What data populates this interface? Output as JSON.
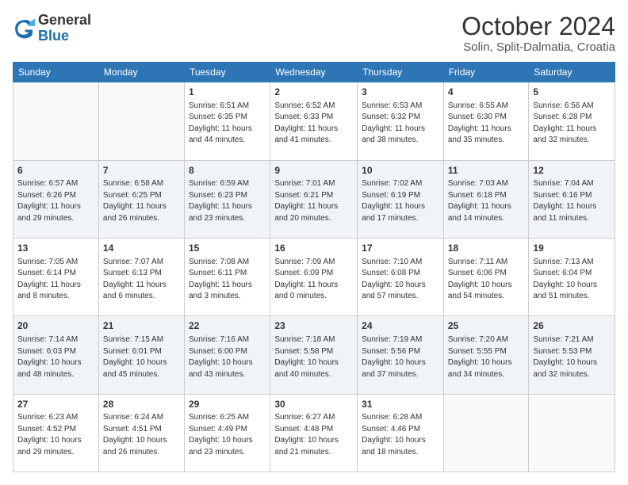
{
  "header": {
    "logo_general": "General",
    "logo_blue": "Blue",
    "title": "October 2024",
    "subtitle": "Solin, Split-Dalmatia, Croatia"
  },
  "calendar": {
    "days": [
      "Sunday",
      "Monday",
      "Tuesday",
      "Wednesday",
      "Thursday",
      "Friday",
      "Saturday"
    ],
    "weeks": [
      [
        {
          "day": "",
          "info": ""
        },
        {
          "day": "",
          "info": ""
        },
        {
          "day": "1",
          "info": "Sunrise: 6:51 AM\nSunset: 6:35 PM\nDaylight: 11 hours and 44 minutes."
        },
        {
          "day": "2",
          "info": "Sunrise: 6:52 AM\nSunset: 6:33 PM\nDaylight: 11 hours and 41 minutes."
        },
        {
          "day": "3",
          "info": "Sunrise: 6:53 AM\nSunset: 6:32 PM\nDaylight: 11 hours and 38 minutes."
        },
        {
          "day": "4",
          "info": "Sunrise: 6:55 AM\nSunset: 6:30 PM\nDaylight: 11 hours and 35 minutes."
        },
        {
          "day": "5",
          "info": "Sunrise: 6:56 AM\nSunset: 6:28 PM\nDaylight: 11 hours and 32 minutes."
        }
      ],
      [
        {
          "day": "6",
          "info": "Sunrise: 6:57 AM\nSunset: 6:26 PM\nDaylight: 11 hours and 29 minutes."
        },
        {
          "day": "7",
          "info": "Sunrise: 6:58 AM\nSunset: 6:25 PM\nDaylight: 11 hours and 26 minutes."
        },
        {
          "day": "8",
          "info": "Sunrise: 6:59 AM\nSunset: 6:23 PM\nDaylight: 11 hours and 23 minutes."
        },
        {
          "day": "9",
          "info": "Sunrise: 7:01 AM\nSunset: 6:21 PM\nDaylight: 11 hours and 20 minutes."
        },
        {
          "day": "10",
          "info": "Sunrise: 7:02 AM\nSunset: 6:19 PM\nDaylight: 11 hours and 17 minutes."
        },
        {
          "day": "11",
          "info": "Sunrise: 7:03 AM\nSunset: 6:18 PM\nDaylight: 11 hours and 14 minutes."
        },
        {
          "day": "12",
          "info": "Sunrise: 7:04 AM\nSunset: 6:16 PM\nDaylight: 11 hours and 11 minutes."
        }
      ],
      [
        {
          "day": "13",
          "info": "Sunrise: 7:05 AM\nSunset: 6:14 PM\nDaylight: 11 hours and 8 minutes."
        },
        {
          "day": "14",
          "info": "Sunrise: 7:07 AM\nSunset: 6:13 PM\nDaylight: 11 hours and 6 minutes."
        },
        {
          "day": "15",
          "info": "Sunrise: 7:08 AM\nSunset: 6:11 PM\nDaylight: 11 hours and 3 minutes."
        },
        {
          "day": "16",
          "info": "Sunrise: 7:09 AM\nSunset: 6:09 PM\nDaylight: 11 hours and 0 minutes."
        },
        {
          "day": "17",
          "info": "Sunrise: 7:10 AM\nSunset: 6:08 PM\nDaylight: 10 hours and 57 minutes."
        },
        {
          "day": "18",
          "info": "Sunrise: 7:11 AM\nSunset: 6:06 PM\nDaylight: 10 hours and 54 minutes."
        },
        {
          "day": "19",
          "info": "Sunrise: 7:13 AM\nSunset: 6:04 PM\nDaylight: 10 hours and 51 minutes."
        }
      ],
      [
        {
          "day": "20",
          "info": "Sunrise: 7:14 AM\nSunset: 6:03 PM\nDaylight: 10 hours and 48 minutes."
        },
        {
          "day": "21",
          "info": "Sunrise: 7:15 AM\nSunset: 6:01 PM\nDaylight: 10 hours and 45 minutes."
        },
        {
          "day": "22",
          "info": "Sunrise: 7:16 AM\nSunset: 6:00 PM\nDaylight: 10 hours and 43 minutes."
        },
        {
          "day": "23",
          "info": "Sunrise: 7:18 AM\nSunset: 5:58 PM\nDaylight: 10 hours and 40 minutes."
        },
        {
          "day": "24",
          "info": "Sunrise: 7:19 AM\nSunset: 5:56 PM\nDaylight: 10 hours and 37 minutes."
        },
        {
          "day": "25",
          "info": "Sunrise: 7:20 AM\nSunset: 5:55 PM\nDaylight: 10 hours and 34 minutes."
        },
        {
          "day": "26",
          "info": "Sunrise: 7:21 AM\nSunset: 5:53 PM\nDaylight: 10 hours and 32 minutes."
        }
      ],
      [
        {
          "day": "27",
          "info": "Sunrise: 6:23 AM\nSunset: 4:52 PM\nDaylight: 10 hours and 29 minutes."
        },
        {
          "day": "28",
          "info": "Sunrise: 6:24 AM\nSunset: 4:51 PM\nDaylight: 10 hours and 26 minutes."
        },
        {
          "day": "29",
          "info": "Sunrise: 6:25 AM\nSunset: 4:49 PM\nDaylight: 10 hours and 23 minutes."
        },
        {
          "day": "30",
          "info": "Sunrise: 6:27 AM\nSunset: 4:48 PM\nDaylight: 10 hours and 21 minutes."
        },
        {
          "day": "31",
          "info": "Sunrise: 6:28 AM\nSunset: 4:46 PM\nDaylight: 10 hours and 18 minutes."
        },
        {
          "day": "",
          "info": ""
        },
        {
          "day": "",
          "info": ""
        }
      ]
    ]
  }
}
